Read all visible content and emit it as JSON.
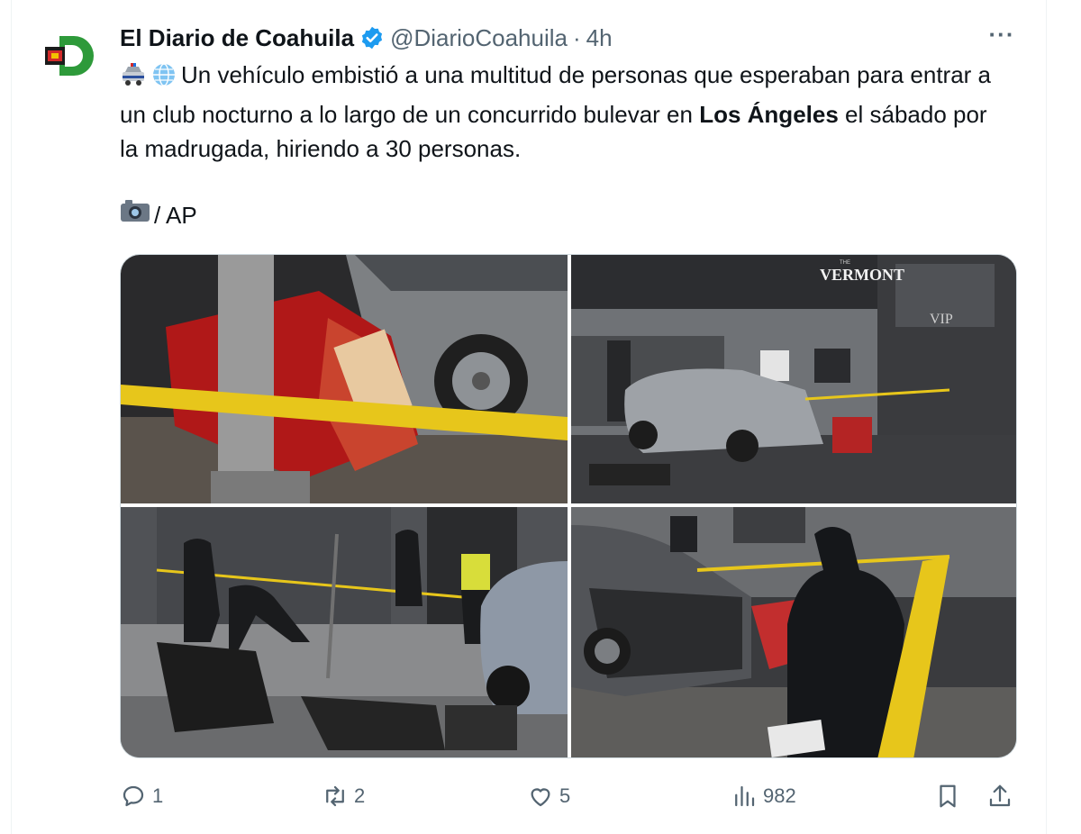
{
  "tweet": {
    "author_name": "El Diario de Coahuila",
    "handle": "@DiarioCoahuila",
    "separator": "·",
    "time": "4h",
    "more_label": "···",
    "text_part1": "Un vehículo embistió a una multitud de personas que esperaban para entrar a un club nocturno a lo largo de un concurrido bulevar en ",
    "text_bold": "Los Ángeles",
    "text_part2": " el sábado por la madrugada, hiriendo a 30 personas.",
    "credit": "/ AP",
    "emojis": [
      "police-car-emoji",
      "globe-emoji",
      "camera-emoji"
    ],
    "photos": [
      {
        "sign": ""
      },
      {
        "sign": "VERMONT",
        "sign_top": "THE",
        "sign_vip": "VIP"
      },
      {
        "sign": ""
      },
      {
        "sign": ""
      }
    ]
  },
  "actions": {
    "reply_count": "1",
    "retweet_count": "2",
    "like_count": "5",
    "views_count": "982"
  },
  "colors": {
    "verified": "#1d9bf0",
    "muted": "#536471",
    "tape": "#e7c61b"
  }
}
